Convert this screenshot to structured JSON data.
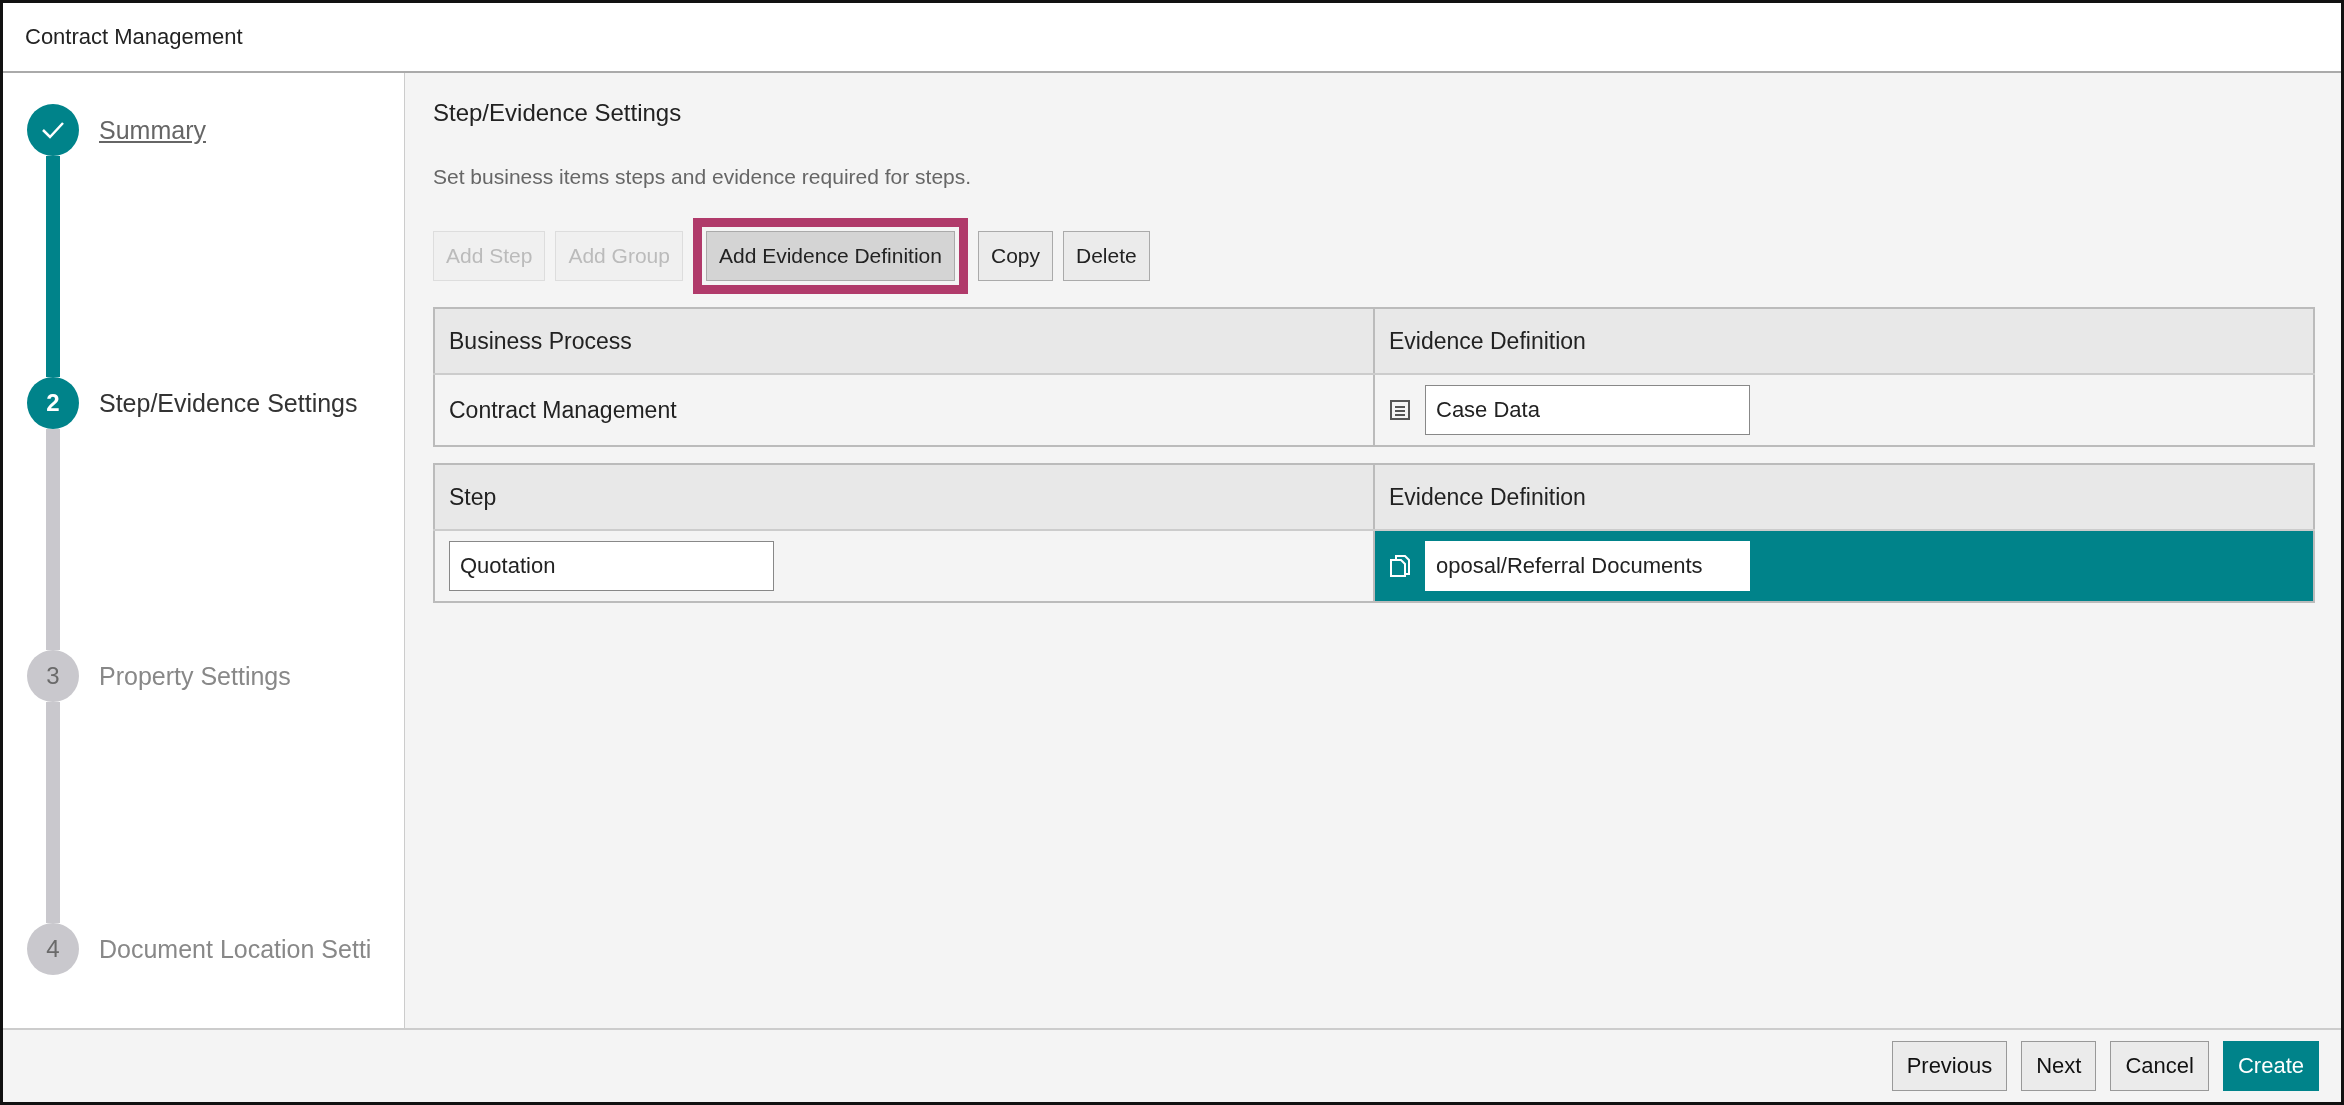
{
  "window": {
    "title": "Contract Management"
  },
  "steps": [
    {
      "label": "Summary",
      "kind": "done"
    },
    {
      "number": "2",
      "label": "Step/Evidence Settings",
      "kind": "current"
    },
    {
      "number": "3",
      "label": "Property Settings",
      "kind": "pending"
    },
    {
      "number": "4",
      "label": "Document Location Setti",
      "kind": "pending"
    }
  ],
  "section": {
    "title": "Step/Evidence Settings",
    "description": "Set business items steps and evidence required for steps."
  },
  "toolbar": [
    {
      "label": "Add Step",
      "disabled": true,
      "highlighted": false
    },
    {
      "label": "Add Group",
      "disabled": true,
      "highlighted": false
    },
    {
      "label": "Add Evidence Definition",
      "disabled": false,
      "highlighted": true
    },
    {
      "label": "Copy",
      "disabled": false,
      "highlighted": false
    },
    {
      "label": "Delete",
      "disabled": false,
      "highlighted": false
    }
  ],
  "tables": [
    {
      "columns": [
        "Business Process",
        "Evidence Definition"
      ],
      "rows": [
        {
          "name": {
            "kind": "text",
            "text": "Contract Management"
          },
          "evidence": {
            "kind": "data",
            "value": "Case Data"
          },
          "selected": false
        }
      ]
    },
    {
      "columns": [
        "Step",
        "Evidence Definition"
      ],
      "rows": [
        {
          "name": {
            "kind": "input",
            "text": "Quotation"
          },
          "evidence": {
            "kind": "file",
            "value": "oposal/Referral Documents"
          },
          "selected": true
        }
      ]
    }
  ],
  "footer_buttons": [
    {
      "label": "Previous",
      "kind": "default"
    },
    {
      "label": "Next",
      "kind": "default"
    },
    {
      "label": "Cancel",
      "kind": "default"
    },
    {
      "label": "Create",
      "kind": "primary"
    }
  ]
}
